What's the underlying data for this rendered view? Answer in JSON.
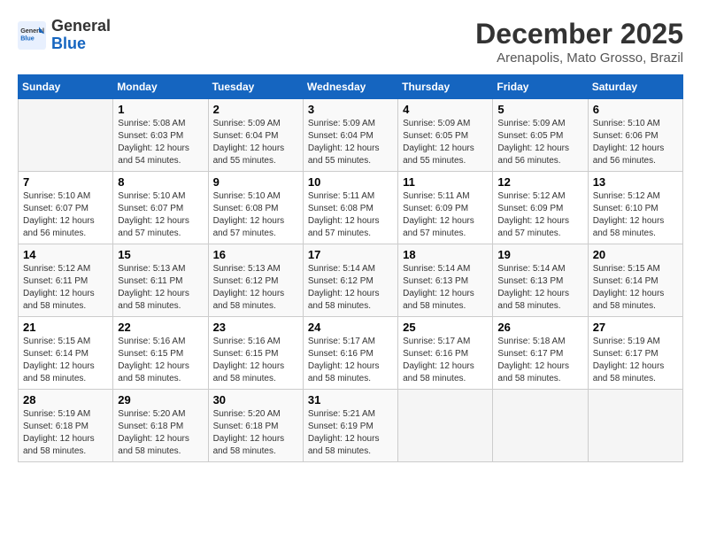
{
  "header": {
    "logo_general": "General",
    "logo_blue": "Blue",
    "calendar_title": "December 2025",
    "calendar_subtitle": "Arenapolis, Mato Grosso, Brazil"
  },
  "weekdays": [
    "Sunday",
    "Monday",
    "Tuesday",
    "Wednesday",
    "Thursday",
    "Friday",
    "Saturday"
  ],
  "weeks": [
    [
      {
        "day": "",
        "empty": true
      },
      {
        "day": "1",
        "sunrise": "5:08 AM",
        "sunset": "6:03 PM",
        "daylight": "12 hours and 54 minutes."
      },
      {
        "day": "2",
        "sunrise": "5:09 AM",
        "sunset": "6:04 PM",
        "daylight": "12 hours and 55 minutes."
      },
      {
        "day": "3",
        "sunrise": "5:09 AM",
        "sunset": "6:04 PM",
        "daylight": "12 hours and 55 minutes."
      },
      {
        "day": "4",
        "sunrise": "5:09 AM",
        "sunset": "6:05 PM",
        "daylight": "12 hours and 55 minutes."
      },
      {
        "day": "5",
        "sunrise": "5:09 AM",
        "sunset": "6:05 PM",
        "daylight": "12 hours and 56 minutes."
      },
      {
        "day": "6",
        "sunrise": "5:10 AM",
        "sunset": "6:06 PM",
        "daylight": "12 hours and 56 minutes."
      }
    ],
    [
      {
        "day": "7",
        "sunrise": "5:10 AM",
        "sunset": "6:07 PM",
        "daylight": "12 hours and 56 minutes."
      },
      {
        "day": "8",
        "sunrise": "5:10 AM",
        "sunset": "6:07 PM",
        "daylight": "12 hours and 57 minutes."
      },
      {
        "day": "9",
        "sunrise": "5:10 AM",
        "sunset": "6:08 PM",
        "daylight": "12 hours and 57 minutes."
      },
      {
        "day": "10",
        "sunrise": "5:11 AM",
        "sunset": "6:08 PM",
        "daylight": "12 hours and 57 minutes."
      },
      {
        "day": "11",
        "sunrise": "5:11 AM",
        "sunset": "6:09 PM",
        "daylight": "12 hours and 57 minutes."
      },
      {
        "day": "12",
        "sunrise": "5:12 AM",
        "sunset": "6:09 PM",
        "daylight": "12 hours and 57 minutes."
      },
      {
        "day": "13",
        "sunrise": "5:12 AM",
        "sunset": "6:10 PM",
        "daylight": "12 hours and 58 minutes."
      }
    ],
    [
      {
        "day": "14",
        "sunrise": "5:12 AM",
        "sunset": "6:11 PM",
        "daylight": "12 hours and 58 minutes."
      },
      {
        "day": "15",
        "sunrise": "5:13 AM",
        "sunset": "6:11 PM",
        "daylight": "12 hours and 58 minutes."
      },
      {
        "day": "16",
        "sunrise": "5:13 AM",
        "sunset": "6:12 PM",
        "daylight": "12 hours and 58 minutes."
      },
      {
        "day": "17",
        "sunrise": "5:14 AM",
        "sunset": "6:12 PM",
        "daylight": "12 hours and 58 minutes."
      },
      {
        "day": "18",
        "sunrise": "5:14 AM",
        "sunset": "6:13 PM",
        "daylight": "12 hours and 58 minutes."
      },
      {
        "day": "19",
        "sunrise": "5:14 AM",
        "sunset": "6:13 PM",
        "daylight": "12 hours and 58 minutes."
      },
      {
        "day": "20",
        "sunrise": "5:15 AM",
        "sunset": "6:14 PM",
        "daylight": "12 hours and 58 minutes."
      }
    ],
    [
      {
        "day": "21",
        "sunrise": "5:15 AM",
        "sunset": "6:14 PM",
        "daylight": "12 hours and 58 minutes."
      },
      {
        "day": "22",
        "sunrise": "5:16 AM",
        "sunset": "6:15 PM",
        "daylight": "12 hours and 58 minutes."
      },
      {
        "day": "23",
        "sunrise": "5:16 AM",
        "sunset": "6:15 PM",
        "daylight": "12 hours and 58 minutes."
      },
      {
        "day": "24",
        "sunrise": "5:17 AM",
        "sunset": "6:16 PM",
        "daylight": "12 hours and 58 minutes."
      },
      {
        "day": "25",
        "sunrise": "5:17 AM",
        "sunset": "6:16 PM",
        "daylight": "12 hours and 58 minutes."
      },
      {
        "day": "26",
        "sunrise": "5:18 AM",
        "sunset": "6:17 PM",
        "daylight": "12 hours and 58 minutes."
      },
      {
        "day": "27",
        "sunrise": "5:19 AM",
        "sunset": "6:17 PM",
        "daylight": "12 hours and 58 minutes."
      }
    ],
    [
      {
        "day": "28",
        "sunrise": "5:19 AM",
        "sunset": "6:18 PM",
        "daylight": "12 hours and 58 minutes."
      },
      {
        "day": "29",
        "sunrise": "5:20 AM",
        "sunset": "6:18 PM",
        "daylight": "12 hours and 58 minutes."
      },
      {
        "day": "30",
        "sunrise": "5:20 AM",
        "sunset": "6:18 PM",
        "daylight": "12 hours and 58 minutes."
      },
      {
        "day": "31",
        "sunrise": "5:21 AM",
        "sunset": "6:19 PM",
        "daylight": "12 hours and 58 minutes."
      },
      {
        "day": "",
        "empty": true
      },
      {
        "day": "",
        "empty": true
      },
      {
        "day": "",
        "empty": true
      }
    ]
  ]
}
